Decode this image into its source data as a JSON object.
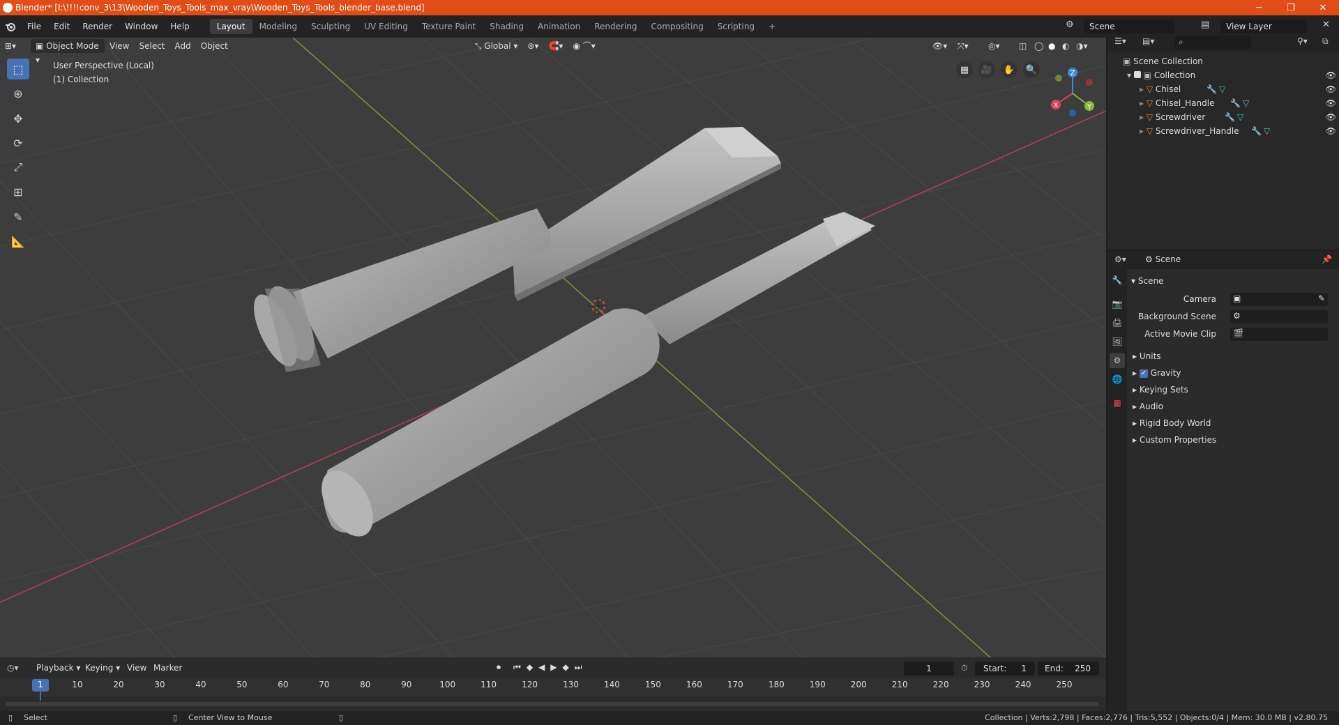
{
  "window": {
    "title": "Blender* [I:\\!!!!conv_3\\13\\Wooden_Toys_Tools_max_vray\\Wooden_Toys_Tools_blender_base.blend]",
    "minimize": "─",
    "restore": "❐",
    "close": "✕"
  },
  "menu": [
    "File",
    "Edit",
    "Render",
    "Window",
    "Help"
  ],
  "workspaces": [
    "Layout",
    "Modeling",
    "Sculpting",
    "UV Editing",
    "Texture Paint",
    "Shading",
    "Animation",
    "Rendering",
    "Compositing",
    "Scripting"
  ],
  "active_workspace": "Layout",
  "add_workspace": "+",
  "scene_name": "Scene",
  "view_layer": "View Layer",
  "viewport": {
    "mode": "Object Mode",
    "menus": [
      "View",
      "Select",
      "Add",
      "Object"
    ],
    "transform_orientation": "Global",
    "info_line1": "User Perspective (Local)",
    "info_line2": "(1) Collection",
    "gizmo": {
      "x": "X",
      "y": "Y",
      "z": "Z"
    }
  },
  "outliner": {
    "root": "Scene Collection",
    "collection": "Collection",
    "objects": [
      "Chisel",
      "Chisel_Handle",
      "Screwdriver",
      "Screwdriver_Handle"
    ]
  },
  "properties": {
    "header": "Scene",
    "panel_title": "Scene",
    "fields": [
      {
        "label": "Camera"
      },
      {
        "label": "Background Scene"
      },
      {
        "label": "Active Movie Clip"
      }
    ],
    "sections": [
      "Units",
      "Gravity",
      "Keying Sets",
      "Audio",
      "Rigid Body World",
      "Custom Properties"
    ]
  },
  "timeline": {
    "menus": [
      "Playback",
      "Keying",
      "View",
      "Marker"
    ],
    "current_frame": "1",
    "start_label": "Start:",
    "start": "1",
    "end_label": "End:",
    "end": "250",
    "ticks": [
      "1",
      "10",
      "20",
      "30",
      "40",
      "50",
      "60",
      "70",
      "80",
      "90",
      "100",
      "110",
      "120",
      "130",
      "140",
      "150",
      "160",
      "170",
      "180",
      "190",
      "200",
      "210",
      "220",
      "230",
      "240",
      "250"
    ]
  },
  "status": {
    "left1": "Select",
    "left2": "Center View to Mouse",
    "right": "Collection | Verts:2,798 | Faces:2,776 | Tris:5,552 | Objects:0/4 | Mem: 30.0 MB | v2.80.75"
  },
  "colors": {
    "accent": "#4772b3",
    "titlebar": "#e24d17",
    "x_axis": "#d6455a",
    "y_axis": "#8ab83a",
    "z_axis": "#3d88d8"
  }
}
